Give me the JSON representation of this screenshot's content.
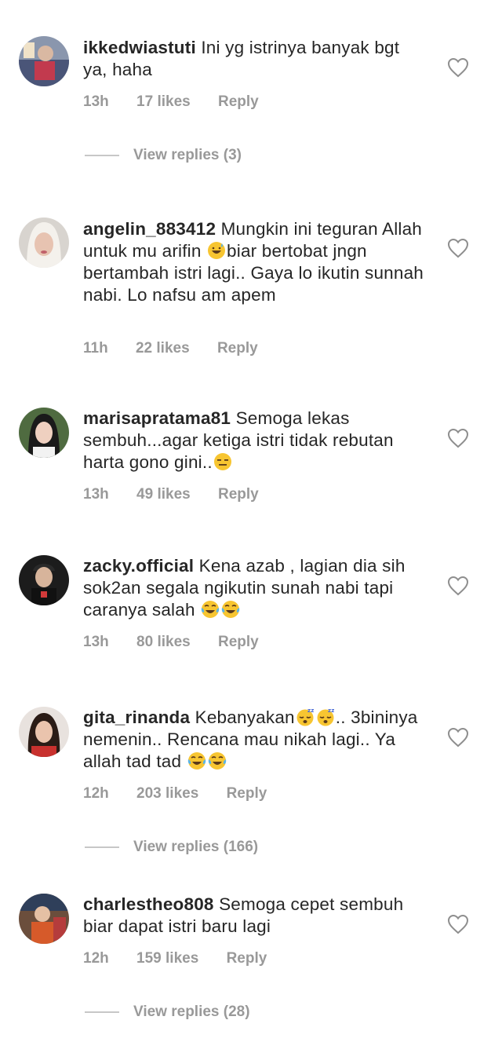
{
  "comments": [
    {
      "username": "ikkedwiastuti",
      "text": "Ini yg istrinya banyak bgt ya,  haha",
      "time": "13h",
      "likes": "17 likes",
      "reply": "Reply",
      "view_replies": "View replies (3)",
      "avatar_color": "#5a6b8a"
    },
    {
      "username": "angelin_883412",
      "text": "Mungkin ini teguran Allah untuk mu arifin 😅biar bertobat jngn bertambah istri lagi.. Gaya lo ikutin sunnah nabi. Lo nafsu am apem",
      "time": "11h",
      "likes": "22 likes",
      "reply": "Reply",
      "avatar_color": "#b9b3ad"
    },
    {
      "username": "marisapratama81",
      "text": "Semoga lekas sembuh...agar ketiga istri tidak rebutan harta gono gini..😑",
      "time": "13h",
      "likes": "49 likes",
      "reply": "Reply",
      "avatar_color": "#3e5a3a"
    },
    {
      "username": "zacky.official",
      "text": "Kena azab , lagian dia sih sok2an segala ngikutin sunah nabi tapi caranya salah 😂😂",
      "time": "13h",
      "likes": "80 likes",
      "reply": "Reply",
      "avatar_color": "#1f1f1f"
    },
    {
      "username": "gita_rinanda",
      "text": "Kebanyakan😴😴.. 3bininya nemenin.. Rencana mau nikah lagi.. Ya allah tad tad 😂😂",
      "time": "12h",
      "likes": "203 likes",
      "reply": "Reply",
      "view_replies": "View replies (166)",
      "avatar_color": "#c0443c"
    },
    {
      "username": "charlestheo808",
      "text": "Semoga cepet sembuh biar dapat istri baru lagi",
      "time": "12h",
      "likes": "159 likes",
      "reply": "Reply",
      "view_replies": "View replies (28)",
      "avatar_color": "#7a5a44"
    }
  ],
  "icons": {
    "like": "heart-outline-icon"
  },
  "colors": {
    "text": "#262626",
    "meta": "#999999",
    "divider": "#c7c7c7"
  }
}
